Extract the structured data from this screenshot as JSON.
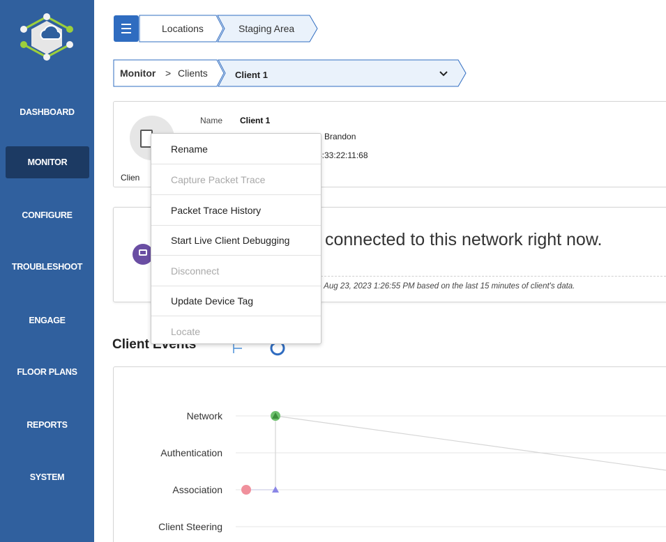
{
  "sidebar": {
    "items": [
      {
        "label": "DASHBOARD",
        "active": false
      },
      {
        "label": "MONITOR",
        "active": true
      },
      {
        "label": "CONFIGURE",
        "active": false
      },
      {
        "label": "TROUBLESHOOT",
        "active": false
      },
      {
        "label": "ENGAGE",
        "active": false
      },
      {
        "label": "FLOOR PLANS",
        "active": false
      },
      {
        "label": "REPORTS",
        "active": false
      },
      {
        "label": "SYSTEM",
        "active": false
      }
    ]
  },
  "location_breadcrumb": {
    "items": [
      "Locations",
      "Staging Area"
    ]
  },
  "section_breadcrumb": {
    "section": "Monitor",
    "separator": ">",
    "page": "Clients",
    "selected_client": "Client 1"
  },
  "client_card": {
    "name_label": "Name",
    "name_value": "Client 1",
    "type_partial": "Clien",
    "owner_partial": "h Brandon",
    "mac_partial": "4:33:22:11:68"
  },
  "status_card": {
    "headline": "connected to this network right now.",
    "footnote": "n Aug 23, 2023 1:26:55 PM based on the last 15 minutes of client's data."
  },
  "context_menu": {
    "items": [
      {
        "label": "Rename",
        "disabled": false
      },
      {
        "label": "Capture Packet Trace",
        "disabled": true
      },
      {
        "label": "Packet Trace History",
        "disabled": false
      },
      {
        "label": "Start Live Client Debugging",
        "disabled": false
      },
      {
        "label": "Disconnect",
        "disabled": true
      },
      {
        "label": "Update Device Tag",
        "disabled": false
      },
      {
        "label": "Locate",
        "disabled": true
      }
    ]
  },
  "client_events": {
    "title": "Client Events",
    "rows": [
      "Network",
      "Authentication",
      "Association",
      "Client Steering"
    ]
  },
  "colors": {
    "sidebar": "#30609e",
    "sidebar_active": "#1c3a63",
    "accent": "#2f6cc0",
    "event_success": "#5cb85c",
    "event_failure": "#f08a96",
    "event_info": "#8a86e6"
  },
  "icons": {
    "logo": "cloud-hexagon-logo",
    "menu": "hamburger-icon",
    "client_device": "mobile-device-icon",
    "status": "network-device-icon",
    "filter": "filter-icon",
    "refresh": "refresh-icon",
    "dropdown": "chevron-down-icon"
  }
}
